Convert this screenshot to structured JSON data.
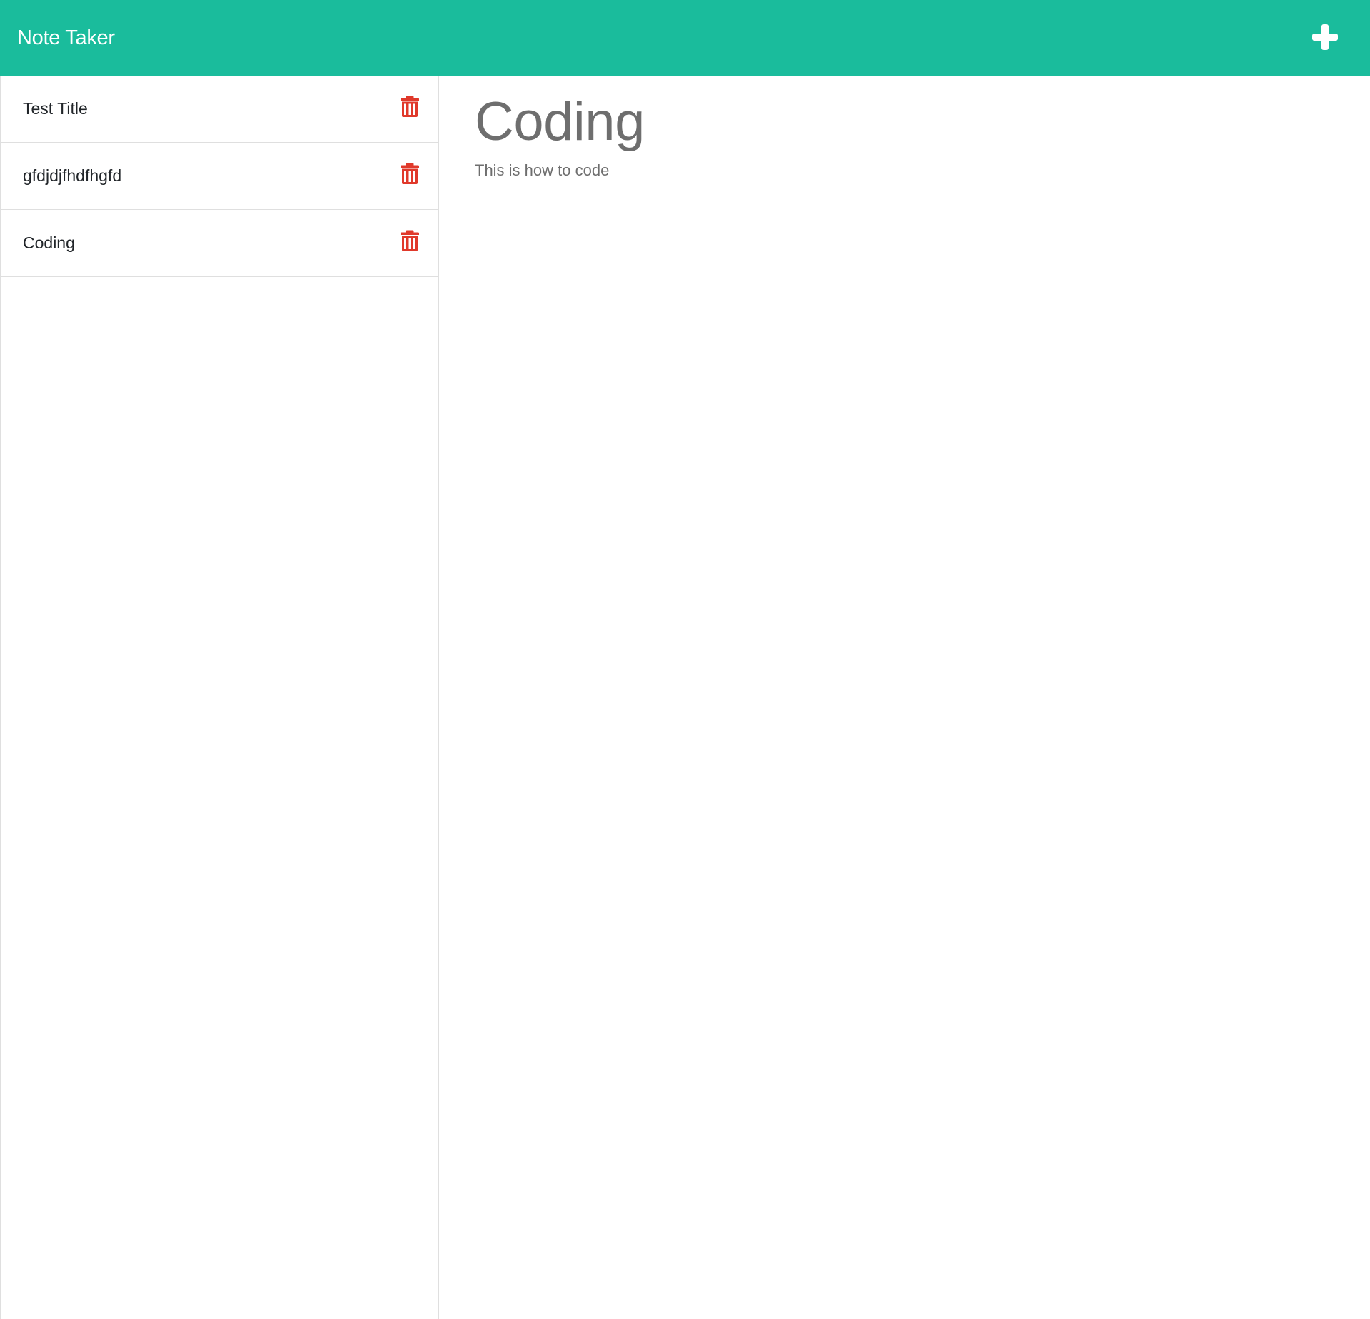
{
  "navbar": {
    "title": "Note Taker",
    "add_icon": "plus-icon",
    "background_color": "#1abc9c"
  },
  "sidebar": {
    "notes": [
      {
        "title": "Test Title",
        "delete_icon": "trash-icon"
      },
      {
        "title": "gfdjdjfhdfhgfd",
        "delete_icon": "trash-icon"
      },
      {
        "title": "Coding",
        "delete_icon": "trash-icon"
      }
    ],
    "delete_icon_color": "#e0392b"
  },
  "active_note": {
    "title": "Coding",
    "text": "This is how to code"
  }
}
